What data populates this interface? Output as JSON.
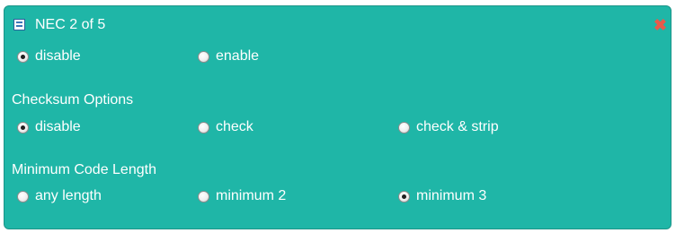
{
  "panel": {
    "title": "NEC 2 of 5",
    "icons": {
      "collapse": "collapse-icon",
      "close": "close-icon"
    },
    "close_glyph": "✖"
  },
  "groups": [
    {
      "label": "",
      "options": [
        {
          "label": "disable",
          "checked": true
        },
        {
          "label": "enable",
          "checked": false
        }
      ]
    },
    {
      "label": "Checksum Options",
      "options": [
        {
          "label": "disable",
          "checked": true
        },
        {
          "label": "check",
          "checked": false
        },
        {
          "label": "check & strip",
          "checked": false
        }
      ]
    },
    {
      "label": "Minimum Code Length",
      "options": [
        {
          "label": "any length",
          "checked": false
        },
        {
          "label": "minimum 2",
          "checked": false
        },
        {
          "label": "minimum 3",
          "checked": true
        }
      ]
    }
  ],
  "colors": {
    "panel_bg": "#1fb6a7",
    "text": "#ffffff",
    "close": "#e85b4b"
  }
}
